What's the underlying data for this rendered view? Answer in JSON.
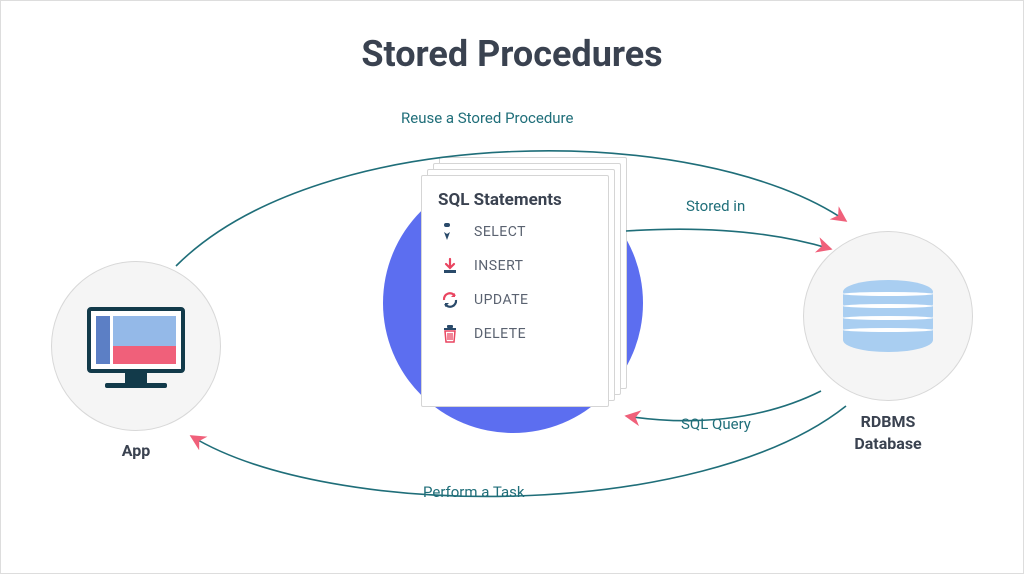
{
  "title": "Stored Procedures",
  "app": {
    "label": "App"
  },
  "center": {
    "card_title": "SQL Statements",
    "statements": [
      {
        "icon": "pointer-icon",
        "label": "SELECT"
      },
      {
        "icon": "download-icon",
        "label": "INSERT"
      },
      {
        "icon": "cycle-icon",
        "label": "UPDATE"
      },
      {
        "icon": "trash-icon",
        "label": "DELETE"
      }
    ]
  },
  "db": {
    "label_line1": "RDBMS",
    "label_line2": "Database"
  },
  "arrows": {
    "reuse": "Reuse a Stored Procedure",
    "stored_in": "Stored in",
    "sql_query": "SQL Query",
    "perform_task": "Perform a Task"
  },
  "colors": {
    "accent_blue": "#5c6ef0",
    "teal": "#1f6e79",
    "pink": "#f0607a",
    "light_blue": "#a9cef1"
  }
}
